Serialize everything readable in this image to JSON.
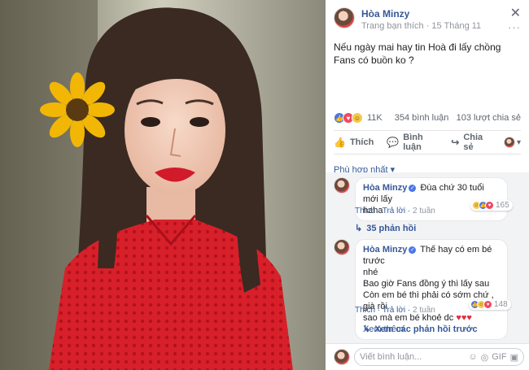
{
  "post": {
    "author": "Hòa Minzy",
    "meta_source": "Trang bạn thích",
    "meta_sep": " · ",
    "meta_date": "15 Tháng 11",
    "meta_globe": "·",
    "close_icon": "✕",
    "more_icon": "···",
    "text_line1": "Nếu ngày mai hay tin Hoà đi lấy chồng",
    "text_line2": "Fans có buồn ko ?",
    "reactions_count": "11K",
    "comments_count": "354 bình luận",
    "shares_count": "103 lượt chia sẻ"
  },
  "actions": {
    "like": "Thích",
    "comment": "Bình luận",
    "share": "Chia sẻ",
    "dropdown": "▾"
  },
  "sort_label": "Phù hợp nhất ▾",
  "comments": [
    {
      "name": "Hòa Minzy",
      "text1": "Đùa chứ 30 tuổi mới lấy",
      "text2": "haha",
      "like": "Thích",
      "reply": "Trả lời",
      "time": "2 tuần",
      "reactions": "165",
      "replies_link": "35 phản hồi"
    },
    {
      "name": "Hòa Minzy",
      "text1": "Thế hay có em bé trước",
      "text2": "nhé",
      "text3": "Bao giờ Fans đồng ý thì lấy sau",
      "text4": "Còn em bé thì phải có sớm chứ , già rồi",
      "text5": "sao mà em bé khoẻ dc",
      "hearts": "♥♥♥",
      "see_more": "Xem thêm",
      "like": "Thích",
      "reply": "Trả lời",
      "time": "2 tuần",
      "reactions": "148"
    }
  ],
  "prev_replies": "Xem các phản hồi trước",
  "input": {
    "placeholder": "Viết bình luận...",
    "icons": [
      "☺",
      "◎",
      "GIF",
      "▣"
    ]
  },
  "colors": {
    "link": "#365899",
    "like_blue": "#4a76e8",
    "love_red": "#ed4960",
    "haha_yellow": "#f7c84b",
    "dress_red": "#d8202a"
  }
}
